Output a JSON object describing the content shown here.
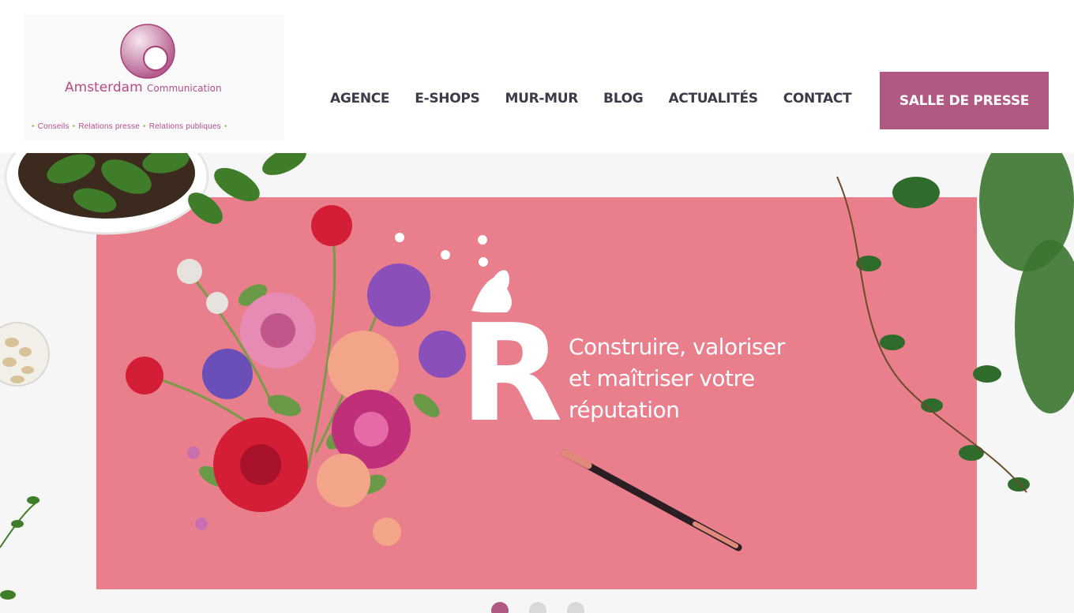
{
  "brand": {
    "name": "Amsterdam",
    "name_suffix": "Communication",
    "tagline": [
      "Conseils",
      "Relations presse",
      "Relations publiques"
    ],
    "color": "#b24f86",
    "accent_dot_color": "#9bc34a"
  },
  "nav": {
    "items": [
      "AGENCE",
      "E-SHOPS",
      "MUR-MUR",
      "BLOG",
      "ACTUALITÉS",
      "CONTACT"
    ],
    "cta": "SALLE DE PRESSE",
    "cta_color": "#b05a83"
  },
  "hero": {
    "headline_lines": [
      "Construire, valoriser",
      "et maîtriser votre",
      "réputation"
    ],
    "big_letter": "R",
    "card_color": "#e97f8c",
    "slides_count": 3,
    "active_slide": 1
  }
}
